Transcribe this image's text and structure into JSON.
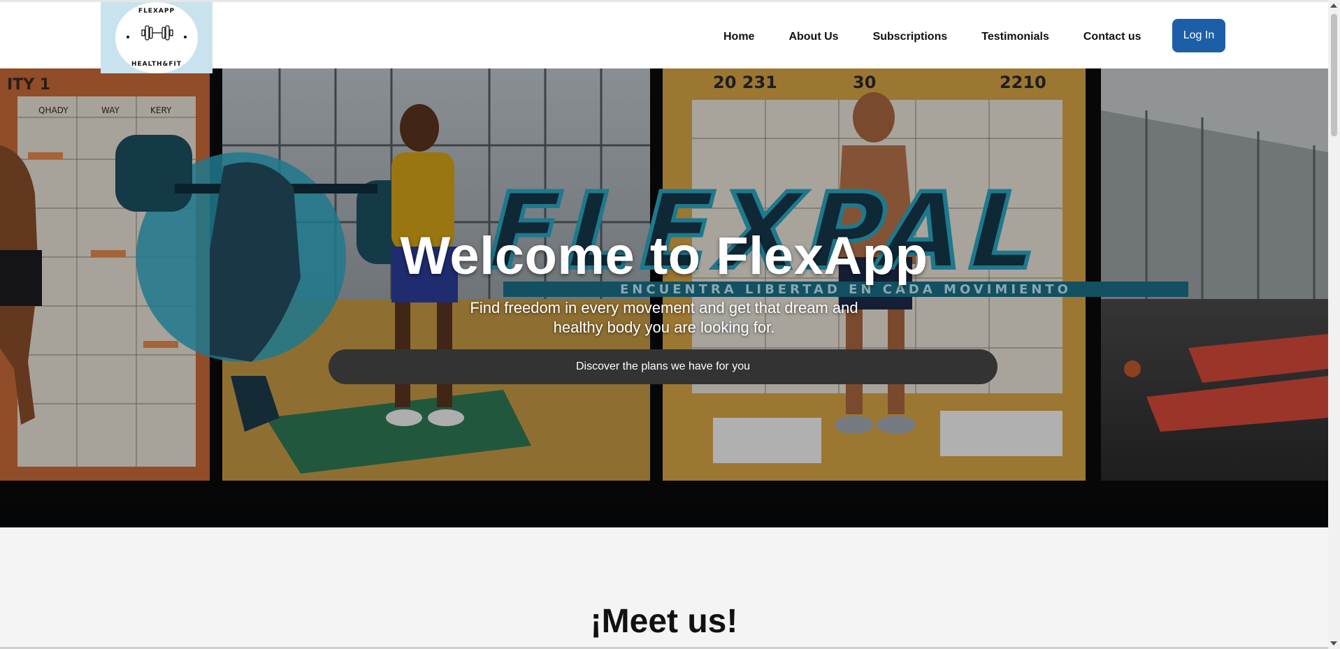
{
  "brand": {
    "logo_top": "FLEXAPP",
    "logo_bottom": "HEALTH&FIT",
    "logo_tagline": "",
    "colors": {
      "logo_bg": "#c9e3ee",
      "accent": "#1d5ea8",
      "hero_art_teal": "#2aa8c4",
      "hero_art_orange": "#e07a3c"
    }
  },
  "nav": {
    "items": [
      {
        "label": "Home"
      },
      {
        "label": "About Us"
      },
      {
        "label": "Subscriptions"
      },
      {
        "label": "Testimonials"
      },
      {
        "label": "Contact us"
      }
    ],
    "login_label": "Log In"
  },
  "hero": {
    "title": "Welcome to FlexApp",
    "subtitle": "Find freedom in every movement and get that dream and healthy body you are looking for.",
    "cta_label": "Discover the plans we have for you",
    "art": {
      "brand_text": "FLEXPAL",
      "slogan": "ENCUENTRA LIBERTAD EN CADA MOVIMIENTO",
      "calendar_header_1": "20 231",
      "calendar_header_2": "30",
      "calendar_header_3": "2210",
      "calendar_header_left": "ITY 1",
      "calendar_cols": [
        "QHADY",
        "WAY",
        "KERY"
      ]
    }
  },
  "meet": {
    "title": "¡Meet us!"
  },
  "icons": {
    "logo": "dumbbell-icon",
    "scroll_up": "arrow-up-icon",
    "scroll_down": "arrow-down-icon"
  }
}
